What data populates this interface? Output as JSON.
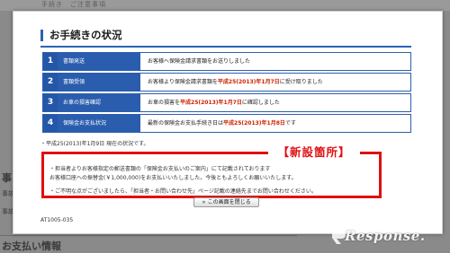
{
  "background": {
    "topbar_text": "手続き　ご注意事項",
    "side_heading": "事",
    "side_text1": "事故照",
    "side_text2": "事故",
    "bottom_heading": "お支払い情報"
  },
  "modal": {
    "title": "お手続きの状況",
    "steps": [
      {
        "num": "1",
        "label": "書類発送",
        "desc": "お客様へ保険金請求書類をお送りしました",
        "desc_after": "",
        "highlight": "",
        "highlight_suffix": ""
      },
      {
        "num": "2",
        "label": "書類受領",
        "desc": "お客様より保険金請求書類を",
        "highlight": "平成25(2013)年1月7日",
        "highlight_suffix": "に受け取りました"
      },
      {
        "num": "3",
        "label": "お車の損害確認",
        "desc": "お車の損害を",
        "highlight": "平成25(2013)年1月7日",
        "highlight_suffix": "に確認しました"
      },
      {
        "num": "4",
        "label": "保険金お支払状況",
        "desc": "最新の保険金お支払手続き日は",
        "highlight": "平成25(2013)年1月8日",
        "highlight_suffix": "です"
      }
    ],
    "confirm_text": "・平成25(2013)年1月9日 現在の状況です。",
    "notice_badge": "【新設箇所】",
    "notice_lines": [
      "・担当者よりお客様指定の郵送書類の「保険金お支払いのご案内」にて記載されております",
      "お客様口座への振替金(￥1,000,000)をお支払いいたしました。今後ともよろしくお願いいたします。",
      "・ご不明な点がございましたら、「担当者・お問い合わせ先」ページ記載の連絡先までお問い合わせください。"
    ],
    "close_button_label": "この画面を閉じる",
    "screen_id": "AT1005-035"
  },
  "watermark": "Response.",
  "colors": {
    "accent": "#2b63b5",
    "highlight": "#cc2200",
    "notice": "#e01010"
  }
}
